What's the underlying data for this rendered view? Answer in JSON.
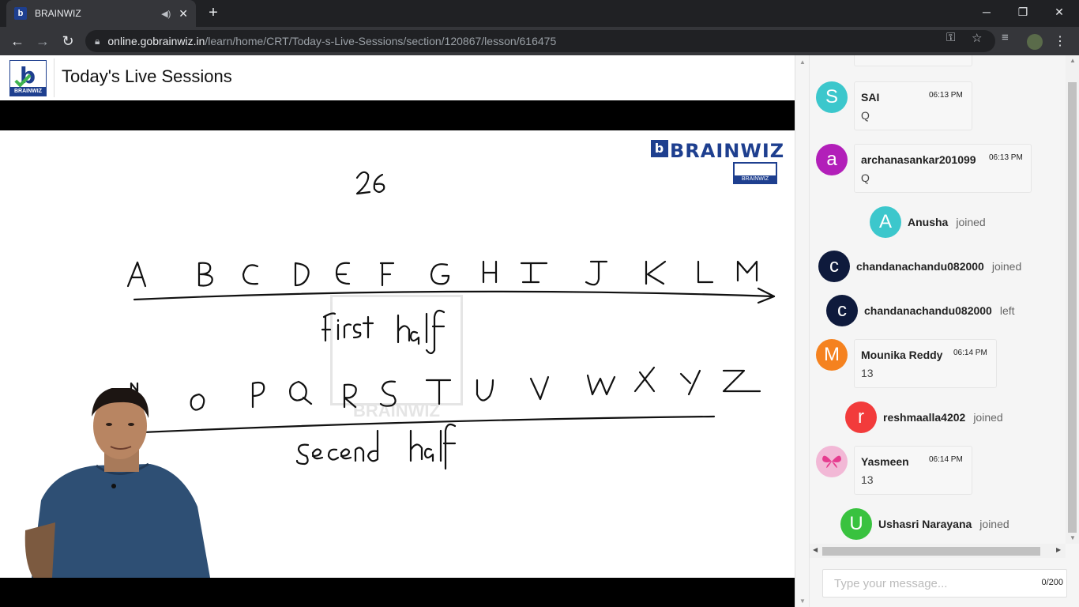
{
  "browser": {
    "tab_title": "BRAINWIZ",
    "favicon_letter": "b",
    "new_tab": "+",
    "url_domain": "online.gobrainwiz.in",
    "url_path": "/learn/home/CRT/Today-s-Live-Sessions/section/120867/lesson/616475",
    "icons": [
      "back-icon",
      "forward-icon",
      "reload-icon",
      "lock-icon",
      "key-icon",
      "star-icon",
      "media-icon",
      "minimize-icon",
      "restore-icon",
      "close-icon"
    ]
  },
  "header": {
    "logo_text": "BRAINWIZ",
    "title": "Today's Live Sessions"
  },
  "board": {
    "brand": "BRAINWIZ",
    "brand_letter": "b",
    "mini_logo": "BRAINWIZ",
    "watermark": "BRAINWIZ"
  },
  "chat": {
    "messages": [
      {
        "type": "message",
        "initial": "S",
        "name": "SAI",
        "time": "06:13 PM",
        "text": "Q",
        "color": "#3cc7cc"
      },
      {
        "type": "message",
        "initial": "a",
        "name": "archanasankar201099",
        "time": "06:13 PM",
        "text": "Q",
        "color": "#b21fb9"
      },
      {
        "type": "event",
        "initial": "A",
        "name": "Anusha",
        "action": "joined",
        "color": "#3cc7cc"
      },
      {
        "type": "event",
        "initial": "c",
        "name": "chandanachandu082000",
        "action": "joined",
        "color": "#0e1a3c"
      },
      {
        "type": "event",
        "initial": "c",
        "name": "chandanachandu082000",
        "action": "left",
        "color": "#0e1a3c"
      },
      {
        "type": "message",
        "initial": "M",
        "name": "Mounika Reddy",
        "time": "06:14 PM",
        "text": "13",
        "color": "#f5821f"
      },
      {
        "type": "event",
        "initial": "r",
        "name": "reshmaalla4202",
        "action": "joined",
        "color": "#f23b3b"
      },
      {
        "type": "message",
        "initial": "",
        "name": "Yasmeen",
        "time": "06:14 PM",
        "text": "13",
        "color": "#f2b8d6"
      },
      {
        "type": "event",
        "initial": "U",
        "name": "Ushasri Narayana",
        "action": "joined",
        "color": "#39c23f"
      }
    ],
    "composer_placeholder": "Type your message...",
    "counter": "0/200"
  }
}
